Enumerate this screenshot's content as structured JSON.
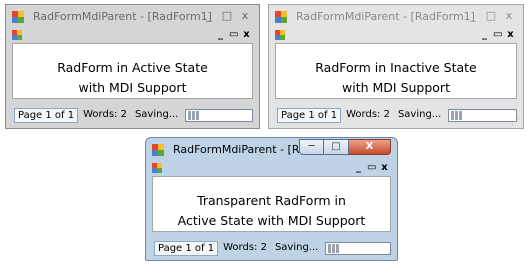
{
  "windows": [
    {
      "title": "RadFormMdiParent - [RadForm1]",
      "state": "active",
      "client_text_line1": "RadForm in Active State",
      "client_text_line2": "with MDI Support",
      "status": {
        "page": "Page 1 of 1",
        "words": "Words: 2",
        "saving": "Saving...",
        "progress_blocks": 3
      }
    },
    {
      "title": "RadFormMdiParent - [RadForm1]",
      "state": "inactive",
      "client_text_line1": "RadForm in Inactive State",
      "client_text_line2": "with MDI Support",
      "status": {
        "page": "Page 1 of 1",
        "words": "Words: 2",
        "saving": "Saving...",
        "progress_blocks": 3
      }
    },
    {
      "title": "RadFormMdiParent - [RadForm3]",
      "state": "active-transparent",
      "client_text_line1": "Transparent RadForm in",
      "client_text_line2": "Active State with MDI Support",
      "status": {
        "page": "Page 1 of 1",
        "words": "Words: 2",
        "saving": "Saving...",
        "progress_blocks": 3
      }
    }
  ],
  "glyphs": {
    "minimize": "_",
    "maximize": "□",
    "close": "x",
    "mdi_minimize": "_",
    "mdi_restore": "▭",
    "mdi_close": "x",
    "aero_minimize": "─",
    "aero_maximize": "□",
    "aero_close": "X",
    "grip": "⋰"
  },
  "colors": {
    "icon_red": "#e8442a",
    "icon_yellow": "#f3c02c",
    "icon_blue": "#4a7fd0",
    "icon_green": "#5aa63a"
  }
}
